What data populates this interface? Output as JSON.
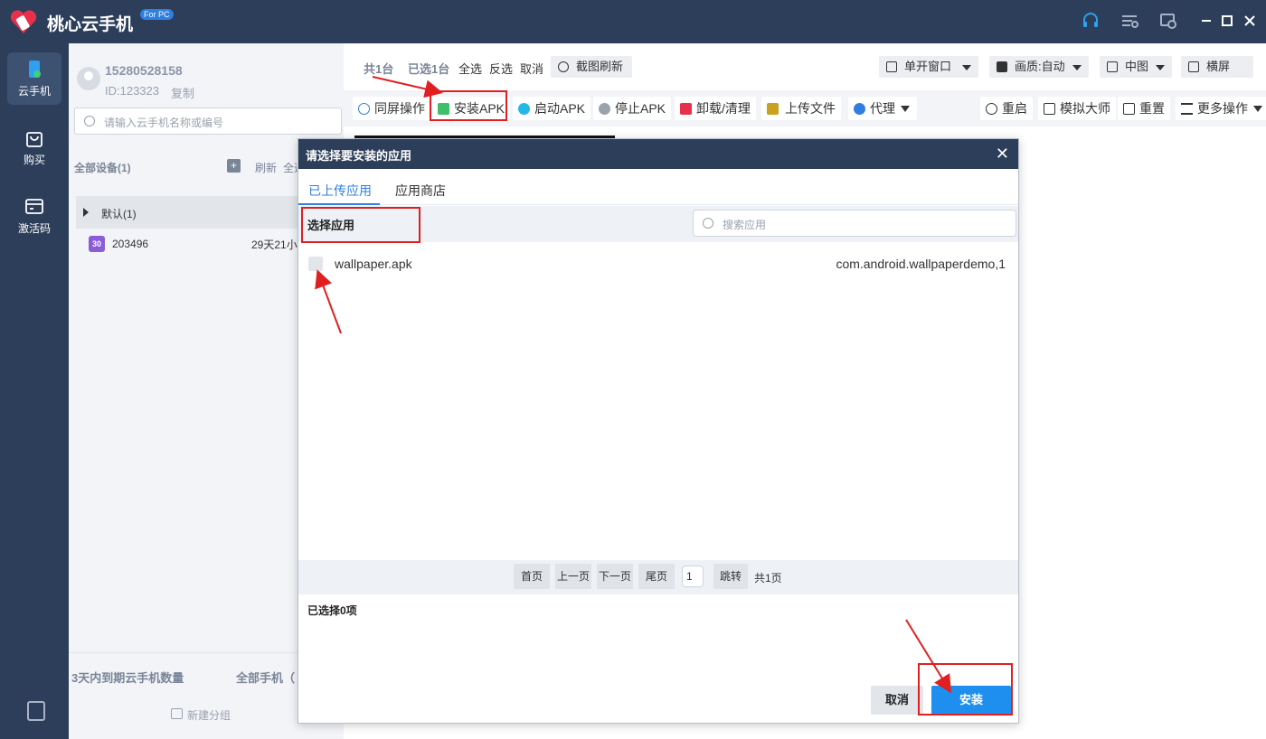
{
  "app": {
    "title": "桃心云手机",
    "badge": "For PC",
    "accent": "#2f7fe0",
    "titlebar_color": "#2c3e5a",
    "titlebar_icons": [
      "headset-icon",
      "settings-icon",
      "feedback-icon",
      "minimize-icon",
      "maximize-icon",
      "close-icon"
    ]
  },
  "nav": {
    "items": [
      {
        "label": "云手机",
        "icon": "phone-icon",
        "active": true
      },
      {
        "label": "购买",
        "icon": "shopping-bag-icon",
        "active": false
      },
      {
        "label": "激活码",
        "icon": "code-card-icon",
        "active": false
      }
    ]
  },
  "account": {
    "phone": "15280528158",
    "id": "ID:123323",
    "copy": "复制"
  },
  "devices": {
    "search_placeholder": "请输入云手机名称或编号",
    "all_label": "全部设备(1)",
    "refresh": "刷新",
    "select_all": "全选",
    "group": "默认(1)",
    "device_badge": "30",
    "device_id": "203496",
    "device_time": "29天21小",
    "expiring": "3天内到期云手机数量",
    "all_phones": "全部手机（",
    "new_group": "新建分组"
  },
  "main": {
    "total": "共1台",
    "selected": "已选1台",
    "select_all": "全选",
    "invert": "反选",
    "cancel": "取消",
    "screenshot_refresh": "截图刷新",
    "window_mode": "单开窗口",
    "quality": "画质:自动",
    "view_size": "中图",
    "landscape": "横屏"
  },
  "toolbar": {
    "sync": "同屏操作",
    "install_apk": "安装APK",
    "launch_apk": "启动APK",
    "stop_apk": "停止APK",
    "uninstall": "卸载/清理",
    "upload": "上传文件",
    "proxy": "代理",
    "restart": "重启",
    "simulator": "模拟大师",
    "reset": "重置",
    "more": "更多操作"
  },
  "dialog": {
    "title": "请选择要安装的应用",
    "tabs": [
      "已上传应用",
      "应用商店"
    ],
    "select_label": "选择应用",
    "search_placeholder": "搜索应用",
    "apps": [
      {
        "name": "wallpaper.apk",
        "package": "com.android.wallpaperdemo,1"
      }
    ],
    "pager": {
      "first": "首页",
      "prev": "上一页",
      "next": "下一页",
      "last": "尾页",
      "page": "1",
      "jump": "跳转",
      "total": "共1页"
    },
    "selected_count": "已选择0项",
    "cancel": "取消",
    "install": "安装"
  }
}
